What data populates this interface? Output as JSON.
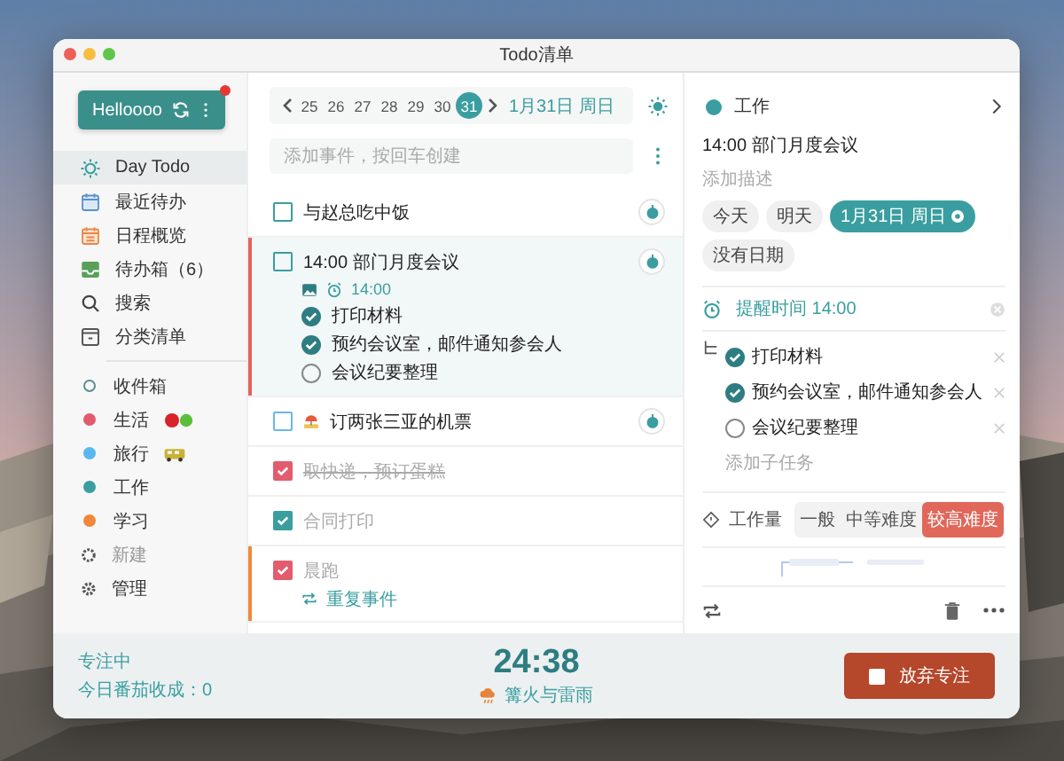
{
  "window": {
    "title": "Todo清单"
  },
  "sidebar": {
    "account": {
      "name": "Helloooo",
      "unread": true
    },
    "nav": [
      {
        "label": "Day Todo",
        "selected": true
      },
      {
        "label": "最近待办",
        "selected": false
      },
      {
        "label": "日程概览",
        "selected": false
      },
      {
        "label": "待办箱（6）",
        "selected": false
      },
      {
        "label": "搜索",
        "selected": false
      },
      {
        "label": "分类清单",
        "selected": false
      }
    ],
    "lists": [
      {
        "label": "收件箱",
        "kind": "ring",
        "color": "#5e8c96"
      },
      {
        "label": "生活",
        "kind": "dot",
        "color": "#e25c6e"
      },
      {
        "label": "旅行",
        "kind": "dot",
        "color": "#5ab8ee"
      },
      {
        "label": "工作",
        "kind": "dot",
        "color": "#3a9ea0"
      },
      {
        "label": "学习",
        "kind": "dot",
        "color": "#f0883a"
      }
    ],
    "actions": [
      {
        "label": "新建",
        "disabled": true
      },
      {
        "label": "管理",
        "disabled": false
      }
    ]
  },
  "day_strip": {
    "days": [
      {
        "label": "25",
        "selected": false
      },
      {
        "label": "26",
        "selected": false
      },
      {
        "label": "27",
        "selected": false
      },
      {
        "label": "28",
        "selected": false
      },
      {
        "label": "29",
        "selected": false
      },
      {
        "label": "30",
        "selected": false
      },
      {
        "label": "31",
        "selected": true
      }
    ],
    "date": "1月31日 周日"
  },
  "new_task": {
    "placeholder": "添加事件，按回车创建"
  },
  "tasks": [
    {
      "title": "与赵总吃中饭",
      "done": false,
      "struck": false,
      "selected": false,
      "color": "#3a9ea0"
    },
    {
      "title": "14:00 部门月度会议",
      "done": false,
      "struck": false,
      "selected": true,
      "color": "#3a9ea0",
      "flag": {
        "color": "#e5625a"
      },
      "reminder": "14:00",
      "subtasks": [
        {
          "title": "打印材料",
          "done": true
        },
        {
          "title": "预约会议室，邮件通知参会人",
          "done": true
        },
        {
          "title": "会议纪要整理",
          "done": false
        }
      ]
    },
    {
      "title": "订两张三亚的机票",
      "done": false,
      "struck": false,
      "selected": false,
      "color": "#6ab8ec"
    },
    {
      "title": "取快递，预订蛋糕",
      "done": true,
      "struck": true,
      "selected": false,
      "color": "#e25c6e"
    },
    {
      "title": "合同打印",
      "done": true,
      "struck": false,
      "selected": false,
      "color": "#3a9ea0"
    },
    {
      "title": "晨跑",
      "done": true,
      "struck": false,
      "selected": false,
      "color": "#e25c6e",
      "flag": {
        "color": "#f0883a"
      },
      "repeat": "重复事件"
    }
  ],
  "detail": {
    "list": {
      "label": "工作",
      "color": "#3a9ea0"
    },
    "title": "14:00 部门月度会议",
    "description": {
      "placeholder": "添加描述"
    },
    "date_options": [
      {
        "label": "今天",
        "selected": false
      },
      {
        "label": "明天",
        "selected": false
      },
      {
        "label": "1月31日 周日",
        "selected": true
      },
      {
        "label": "没有日期",
        "selected": false
      }
    ],
    "reminder": "提醒时间 14:00",
    "subtasks": [
      {
        "title": "打印材料",
        "done": true
      },
      {
        "title": "预约会议室，邮件通知参会人",
        "done": true
      },
      {
        "title": "会议纪要整理",
        "done": false
      }
    ],
    "new_subtask": {
      "placeholder": "添加子任务"
    },
    "workload": {
      "label": "工作量",
      "options": [
        {
          "label": "一般",
          "selected": false
        },
        {
          "label": "中等难度",
          "selected": false
        },
        {
          "label": "较高难度",
          "selected": true
        }
      ]
    }
  },
  "focus": {
    "status": "专注中",
    "harvest": "今日番茄收成：0",
    "timer": "24:38",
    "sound": "篝火与雷雨",
    "button": "放弃专注"
  }
}
